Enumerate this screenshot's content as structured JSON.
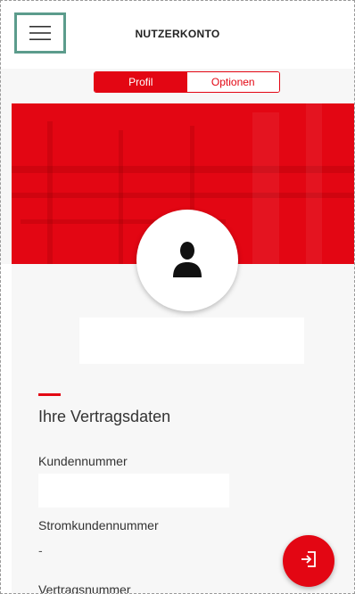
{
  "header": {
    "title": "NUTZERKONTO",
    "menu_icon": "hamburger-menu-icon"
  },
  "tabs": [
    {
      "label": "Profil",
      "active": true
    },
    {
      "label": "Optionen",
      "active": false
    }
  ],
  "profile": {
    "avatar_icon": "user-silhouette-icon"
  },
  "contract": {
    "section_title": "Ihre Vertragsdaten",
    "fields": [
      {
        "label": "Kundennummer",
        "value": ""
      },
      {
        "label": "Stromkundennummer",
        "value": "-"
      },
      {
        "label": "Vertragsnummer",
        "value": ""
      }
    ]
  },
  "fab": {
    "icon": "logout-icon"
  },
  "colors": {
    "accent": "#e30613",
    "menu_focus_border": "#5c9c8c"
  }
}
